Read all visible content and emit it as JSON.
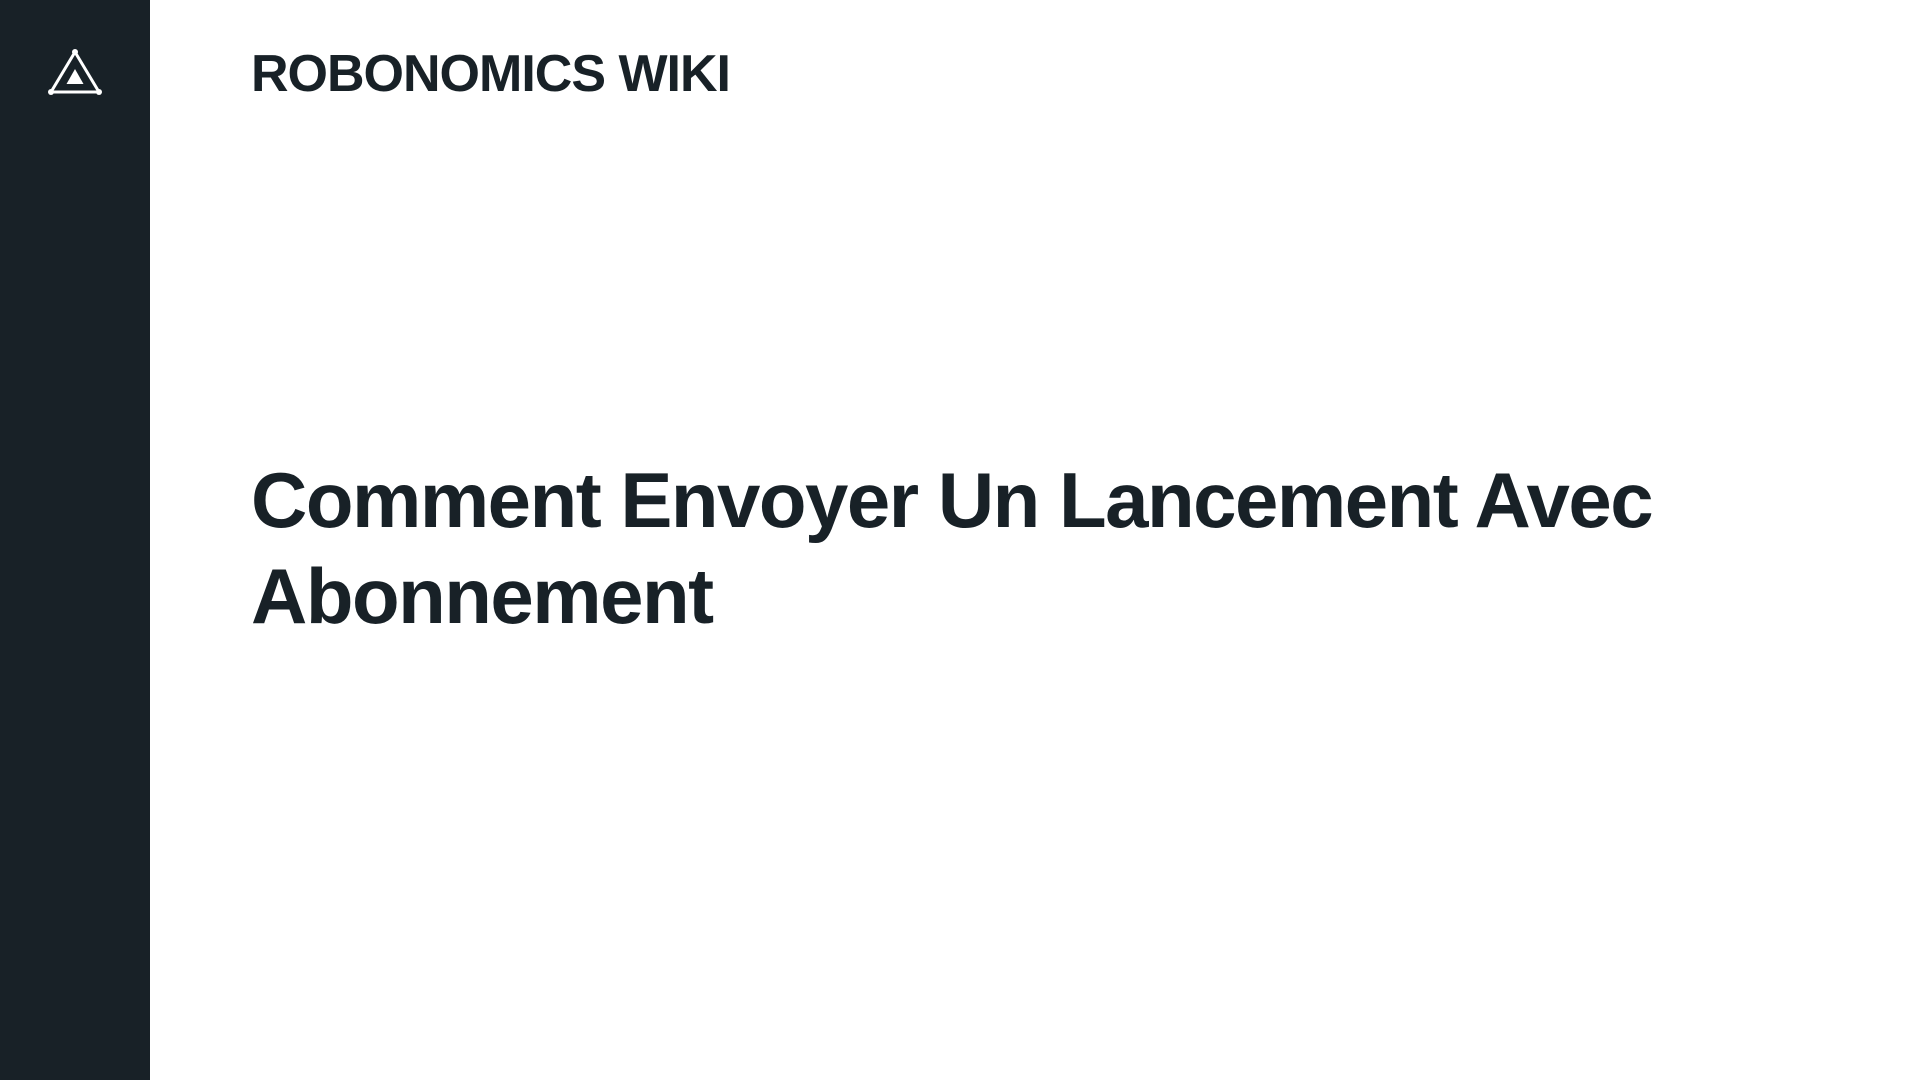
{
  "sidebar": {
    "logo_icon": "robonomics-triangle-logo-icon",
    "background": "#182127"
  },
  "header": {
    "site_title": "ROBONOMICS WIKI"
  },
  "main": {
    "heading": "Comment Envoyer Un Lancement Avec Abonnement"
  },
  "colors": {
    "text": "#182127",
    "background": "#ffffff",
    "logo_stroke": "#ffffff"
  }
}
